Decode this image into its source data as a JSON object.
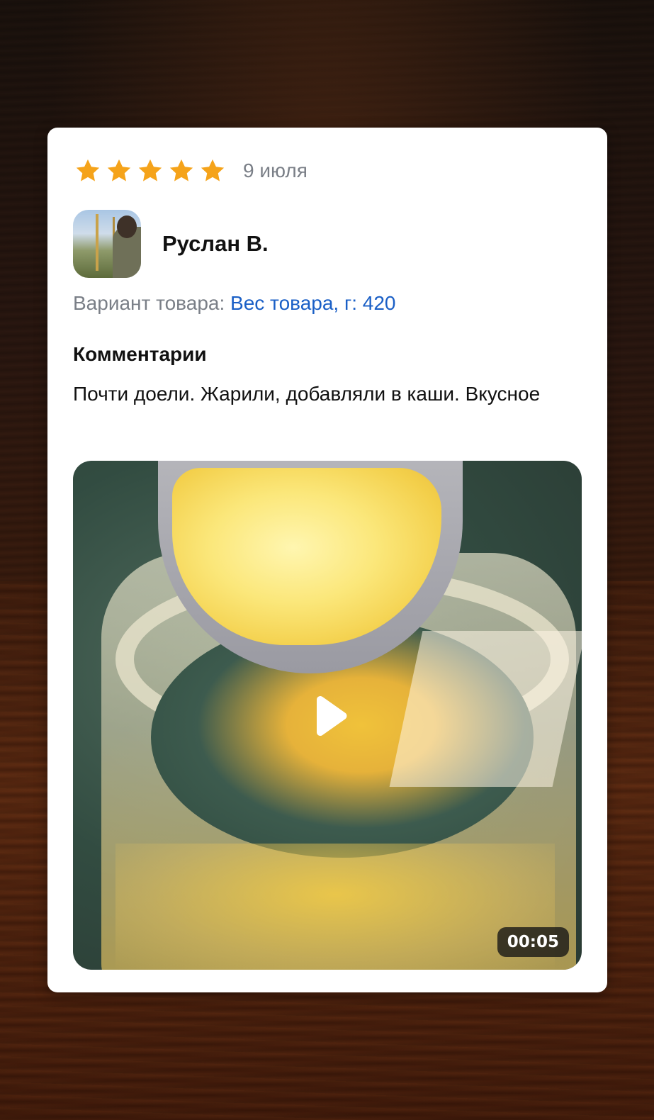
{
  "review": {
    "rating": 5,
    "rating_max": 5,
    "date": "9 июля",
    "author": "Руслан В.",
    "variant_label": "Вариант товара:",
    "variant_value": "Вес товара, г: 420",
    "comments_title": "Комментарии",
    "comment_text": "Почти доели. Жарили, добавляли в каши. Вкусное"
  },
  "video": {
    "duration": "00:05",
    "play_icon": "play-icon"
  },
  "colors": {
    "star": "#F5A31A",
    "link": "#1A5FC6",
    "muted_text": "#7A7F87"
  }
}
